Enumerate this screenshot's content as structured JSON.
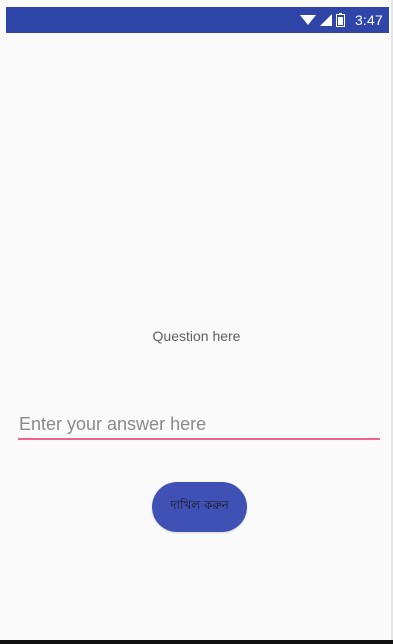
{
  "status_bar": {
    "time": "3:47",
    "icons": [
      "wifi-icon",
      "cellular-signal-icon",
      "battery-icon"
    ],
    "color": "#2f45a8"
  },
  "main": {
    "question_text": "Question here",
    "answer": {
      "value": "",
      "placeholder": "Enter your answer here",
      "underline_color": "#f06292"
    },
    "submit_label": "দাখিল করুন",
    "submit_color": "#3f51b5"
  }
}
